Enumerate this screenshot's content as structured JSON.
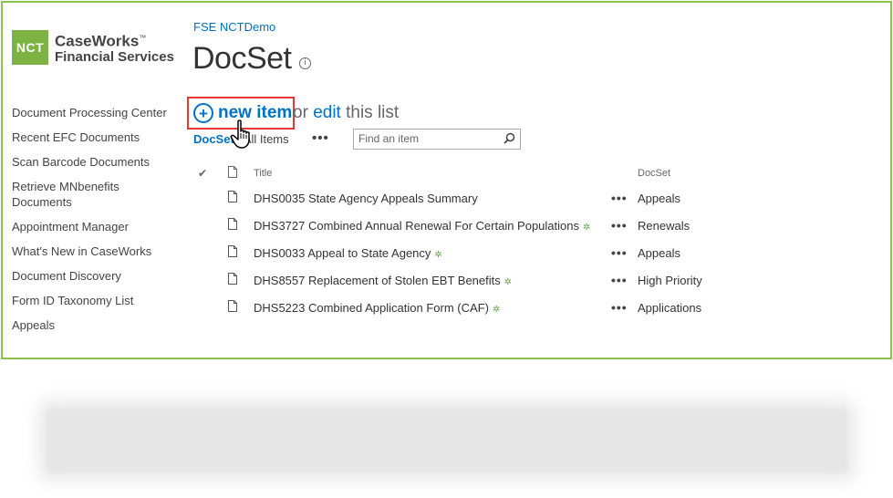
{
  "logo": {
    "badge": "NCT",
    "line1": "CaseWorks",
    "tm": "™",
    "line2": "Financial Services"
  },
  "side_nav": [
    "Document Processing Center",
    "Recent EFC Documents",
    "Scan Barcode Documents",
    "Retrieve MNbenefits Documents",
    "Appointment Manager",
    "What's New in CaseWorks",
    "Document Discovery",
    "Form ID Taxonomy List",
    "Appeals"
  ],
  "breadcrumb": "FSE NCTDemo",
  "page_title": "DocSet",
  "command": {
    "new_item": "new item",
    "or": "or",
    "edit": "edit",
    "this_list": "this list"
  },
  "views": {
    "docset": "DocSet",
    "all_items": "All Items",
    "more": "•••"
  },
  "search": {
    "placeholder": "Find an item"
  },
  "list": {
    "headers": {
      "title": "Title",
      "docset": "DocSet"
    },
    "rows": [
      {
        "title": "DHS0035 State Agency Appeals Summary",
        "is_new": false,
        "docset": "Appeals"
      },
      {
        "title": "DHS3727 Combined Annual Renewal For Certain Populations",
        "is_new": true,
        "docset": "Renewals"
      },
      {
        "title": "DHS0033 Appeal to State Agency",
        "is_new": true,
        "docset": "Appeals"
      },
      {
        "title": "DHS8557 Replacement of Stolen EBT Benefits",
        "is_new": true,
        "docset": "High Priority"
      },
      {
        "title": "DHS5223 Combined Application Form (CAF)",
        "is_new": true,
        "docset": "Applications"
      }
    ],
    "new_badge": "✲",
    "row_menu": "•••"
  },
  "colors": {
    "accent": "#0072c6",
    "frame": "#8bc34a",
    "highlight": "#e53935",
    "new_badge": "#6aa84f"
  }
}
